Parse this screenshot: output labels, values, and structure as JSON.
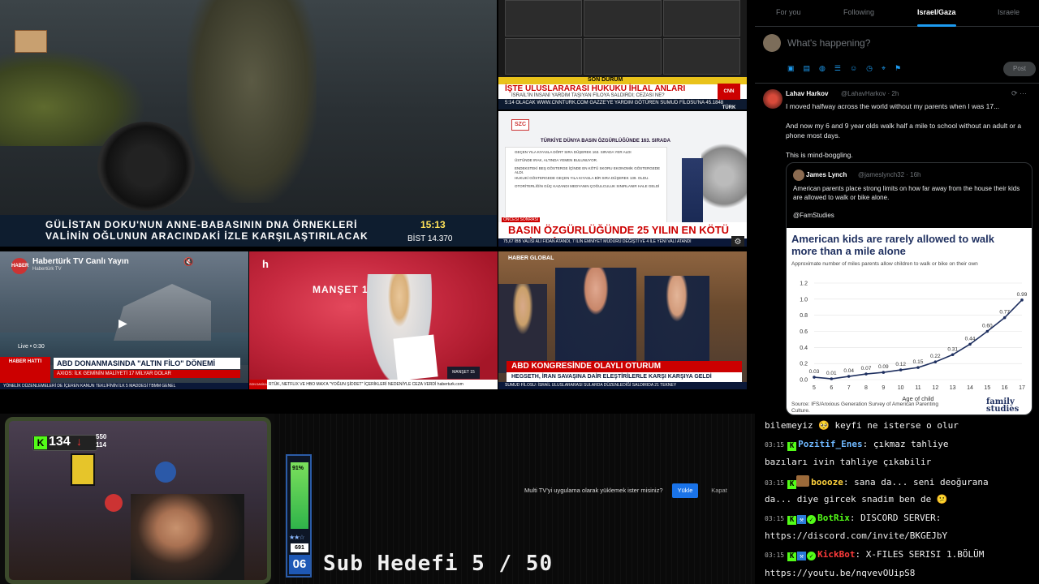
{
  "tv1": {
    "headline": "GÜLİSTAN DOKU'NUN ANNE-BABASININ DNA ÖRNEKLERİ\nVALİNİN OĞLUNUN ARACINDAKİ İZLE KARŞILAŞTIRILACAK",
    "time": "15:13",
    "bist": "BİST  14.370"
  },
  "tv2": {
    "son_durum": "SON DURUM",
    "title": "İŞTE ULUSLARARASI HUKUKU İHLAL ANLARI",
    "sub": "İSRAİL'İN İNSANİ YARDIM TAŞIYAN FİLOYA SALDIRDI; CEZASI NE?",
    "ticker": "5:14 OLACAK   WWW.CNNTURK.COM   GAZZE'YE YARDIM GÖTÜREN SUMUD FİLOSU'NA   45.1848",
    "cnn": "CNN TÜRK"
  },
  "tv3": {
    "logo": "SZC",
    "board_title": "TÜRKİYE DÜNYA BASIN ÖZGÜRLÜĞÜNDE 163. SIRADA",
    "lines": [
      "GEÇEN YILA KIYASLA DÖRT SIRA DÜŞEREK 163. SIRADA YER ALDI",
      "ÜSTÜNDE IRAK, ALTINDA YEMEN BULUNUYOR.",
      "ENDEKSTEKİ BEŞ GÖSTERGE İÇİNDE EN KÖTÜ SKORU EKONOMİK GÖSTERGEDE ALDI.",
      "HUKUKİ GÖSTERGEDE GEÇEN YILA KIYASLA BİR SIRA DÜŞEREK 139. OLDU.",
      "OTORİTERLİĞİN GÜÇ KAZANDI MEDYANIN ÇOĞULCULUK SINIRLANIR HALE GELDİ"
    ],
    "oncesi": "ÖNCESİ SONRASI",
    "headline": "BASIN ÖZGÜRLÜĞÜNDE 25 YILIN EN KÖTÜ SEVİYESİ",
    "ticker": "75,67   İBB VALİSİ ALİ FIDAN ATANDI, 7 İLİN EMNİYET MÜDÜRÜ DEĞİŞTİ VE 4 İLE YENİ VALİ ATANDI"
  },
  "tv4": {
    "channel": "Habertürk TV Canlı Yayın",
    "sub": "Habertürk TV",
    "live": "Live • 0:30",
    "haber": "HABER HATTI",
    "title": "ABD DONANMASINDA \"ALTIN FİLO\" DÖNEMİ",
    "sub2": "AXIOS: İLK GEMİNİN MALİYETİ 17 MİLYAR DOLAR",
    "ticker": "YÖNELİK DÜZENLEMELERİ DE İÇEREN KANUN TEKLİFİNİN İLK 5 MADDESİ TBMM GENEL"
  },
  "tv5": {
    "logo": "h",
    "manset": "MANŞET 15",
    "mini": "MANŞET 15",
    "tag": "SON DAKİKA",
    "ticker": "RTÜK, NETFLIX VE HBO MAX'A \"YOĞUN ŞİDDET\" İÇERİKLERİ NEDENİYLE CEZA VERDİ   haberturk.com"
  },
  "tv6": {
    "logo": "HABER GLOBAL",
    "title": "ABD KONGRESİNDE OLAYLI OTURUM",
    "sub": "HEGSETH, İRAN SAVAŞINA DAİR ELEŞTİRİLERLE KARŞI KARŞIYA GELDİ",
    "ticker": "SUMUD FİLOSU: İSRAİL ULUSLARARASI SULARDA DÜZENLEDİĞİ SALDIRIDA 21 TEKNEY"
  },
  "twitter": {
    "tabs": [
      "For you",
      "Following",
      "Israel/Gaza",
      "Israele"
    ],
    "compose_placeholder": "What's happening?",
    "post_label": "Post",
    "icons": [
      "image-icon",
      "gif-icon",
      "grok-icon",
      "poll-icon",
      "emoji-icon",
      "schedule-icon",
      "location-icon",
      "flag-icon"
    ],
    "post": {
      "name": "Lahav Harkov",
      "handle": "@LahavHarkov · 2h",
      "text": "I moved halfway across the world without my parents when I was 17...\n\nAnd now my 6 and 9 year olds walk half a mile to school without an adult or a phone most days.\n\nThis is mind-boggling."
    },
    "quote": {
      "name": "James Lynch",
      "handle": "@jameslynch32 · 16h",
      "text": "American parents place strong limits on how far away from the house their kids are allowed to walk or bike alone.\n\n@FamStudies"
    },
    "chart_source": "Source: IFS/Anxious Generation Survey of American Parenting Culture.",
    "chart_brand": "family studies"
  },
  "chart_data": {
    "type": "line",
    "title": "American kids are rarely allowed to walk more than a mile alone",
    "subtitle": "Approximate number of miles parents allow children to walk or bike on their own",
    "xlabel": "Age of child",
    "ylabel": "",
    "x": [
      5,
      6,
      7,
      8,
      9,
      10,
      11,
      12,
      13,
      14,
      15,
      16,
      17
    ],
    "values": [
      0.03,
      0.01,
      0.04,
      0.07,
      0.09,
      0.12,
      0.15,
      0.22,
      0.31,
      0.44,
      0.6,
      0.77,
      0.99
    ],
    "labels": [
      "0.03",
      "0.01",
      "0.04",
      "0.07",
      "0.09",
      "0.12",
      "0.15",
      "0.22",
      "0.31",
      "0.44",
      "0.60",
      "0.77",
      "0.99"
    ],
    "yticks": [
      "0.0",
      "0.2",
      "0.4",
      "0.6",
      "0.8",
      "1.0",
      "1.2"
    ],
    "ylim": [
      0,
      1.2
    ],
    "color": "#1e2f5f",
    "grid": true
  },
  "webcam": {
    "kick_count": "134",
    "stat1": "550",
    "stat2": "114"
  },
  "meter": {
    "percent": "91%",
    "stars": "★★☆",
    "number": "691",
    "day": "06",
    "fill_fraction": 0.91
  },
  "sub_goal": "Sub Hedefi 5 / 50",
  "notice": {
    "message": "Multi TV'yi uygulama olarak yüklemek ister misiniz?",
    "install": "Yükle",
    "close": "Kapat"
  },
  "chat": [
    {
      "ts": "",
      "badges": [],
      "user": "",
      "text": "bilemeyiz 🥺 keyfi ne isterse o olur"
    },
    {
      "ts": "03:15",
      "badges": [
        "kick"
      ],
      "user": "Pozitif_Enes",
      "user_color": "#6fb8ff",
      "text": "çıkmaz tahliye"
    },
    {
      "ts": "",
      "badges": [],
      "user": "",
      "text": "bazıları ivin tahliye çıkabilir"
    },
    {
      "ts": "03:15",
      "badges": [
        "kick",
        "emote"
      ],
      "user": "boooze",
      "user_color": "#ffd23c",
      "text": "sana da... seni deoğurana"
    },
    {
      "ts": "",
      "badges": [],
      "user": "",
      "text": "da... diye gircek snadim ben de 😕"
    },
    {
      "ts": "03:15",
      "badges": [
        "kick",
        "mod",
        "verified"
      ],
      "user": "BotRix",
      "user_color": "#53fc18",
      "text": "DISCORD SERVER:"
    },
    {
      "ts": "",
      "badges": [],
      "user": "",
      "text": "https://discord.com/invite/BKGEJbY"
    },
    {
      "ts": "03:15",
      "badges": [
        "kick",
        "mod",
        "verified"
      ],
      "user": "KickBot",
      "user_color": "#ff3b3b",
      "text": "X-FILES SERISI 1.BÖLÜM"
    },
    {
      "ts": "",
      "badges": [],
      "user": "",
      "text": "https://youtu.be/nqvevOUipS8"
    }
  ]
}
